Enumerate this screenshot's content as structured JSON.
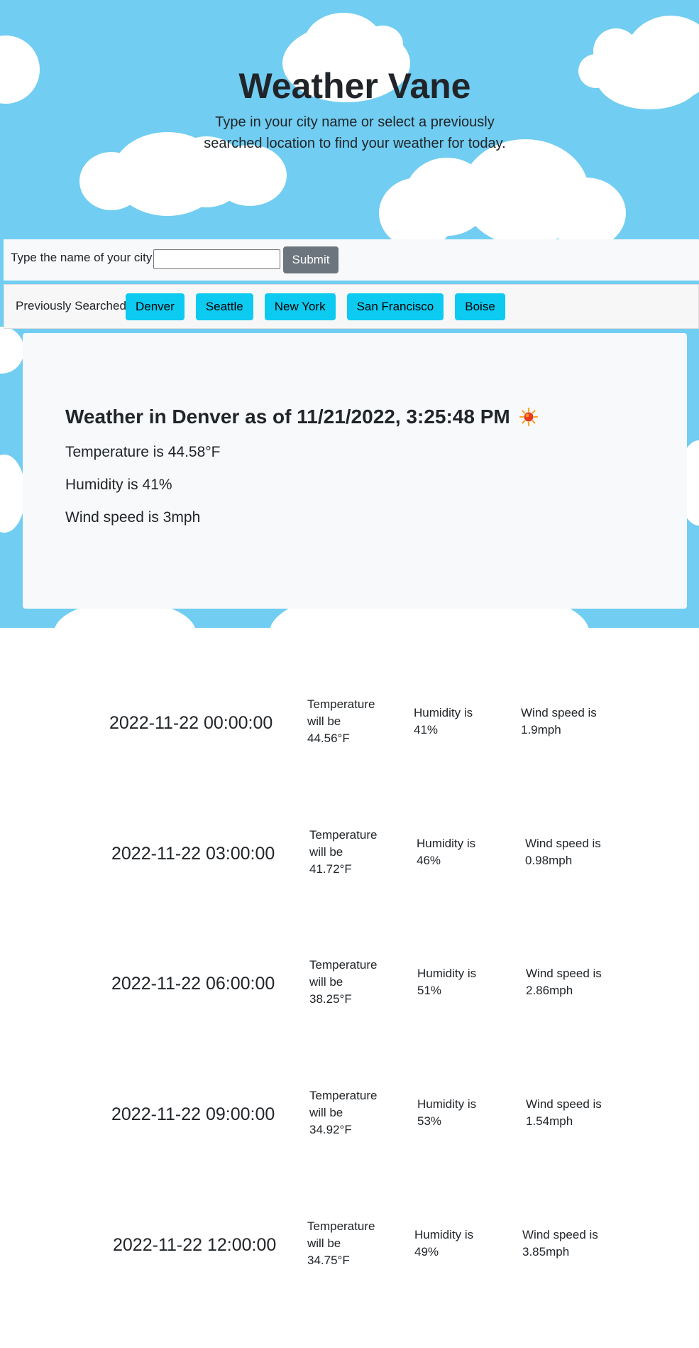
{
  "header": {
    "title": "Weather Vane",
    "subtitle": "Type in your city name or select a previously searched location to find your weather for today."
  },
  "search": {
    "label": "Type the name of your city:",
    "value": "",
    "placeholder": "",
    "submit_label": "Submit"
  },
  "history": {
    "label": "Previously Searched",
    "cities": [
      "Denver",
      "Seattle",
      "New York",
      "San Francisco",
      "Boise"
    ]
  },
  "current": {
    "heading": "Weather in Denver as of 11/21/2022, 3:25:48 PM",
    "icon": "sun-icon",
    "temperature": "Temperature is 44.58°F",
    "humidity": "Humidity is 41%",
    "wind": "Wind speed is 3mph"
  },
  "forecast": [
    {
      "datetime": "2022-11-22 00:00:00",
      "temperature": "Temperature will be 44.56°F",
      "humidity": "Humidity is 41%",
      "wind": "Wind speed is 1.9mph"
    },
    {
      "datetime": "2022-11-22 03:00:00",
      "temperature": "Temperature will be 41.72°F",
      "humidity": "Humidity is 46%",
      "wind": "Wind speed is 0.98mph"
    },
    {
      "datetime": "2022-11-22 06:00:00",
      "temperature": "Temperature will be 38.25°F",
      "humidity": "Humidity is 51%",
      "wind": "Wind speed is 2.86mph"
    },
    {
      "datetime": "2022-11-22 09:00:00",
      "temperature": "Temperature will be 34.92°F",
      "humidity": "Humidity is 53%",
      "wind": "Wind speed is 1.54mph"
    },
    {
      "datetime": "2022-11-22 12:00:00",
      "temperature": "Temperature will be 34.75°F",
      "humidity": "Humidity is 49%",
      "wind": "Wind speed is 3.85mph"
    }
  ],
  "colors": {
    "sky": "#71cdf1",
    "cloud": "#ffffff",
    "city_button": "#0dcaf0",
    "submit_button": "#6c757d",
    "card": "#f8f9fa",
    "text": "#212529"
  }
}
